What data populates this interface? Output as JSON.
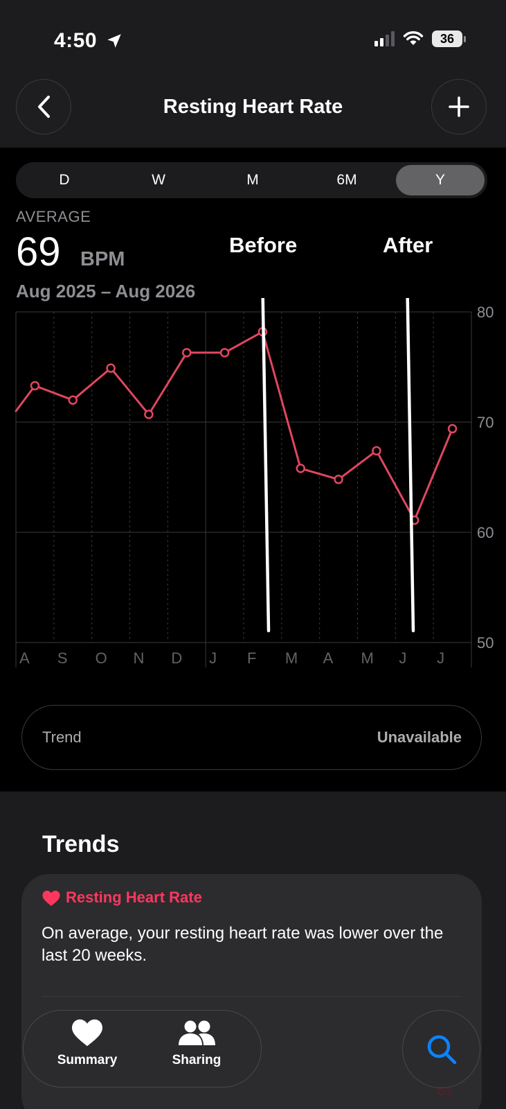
{
  "status_bar": {
    "time": "4:50",
    "battery": "36"
  },
  "header": {
    "title": "Resting Heart Rate"
  },
  "segments": [
    {
      "label": "D",
      "active": false
    },
    {
      "label": "W",
      "active": false
    },
    {
      "label": "M",
      "active": false
    },
    {
      "label": "6M",
      "active": false
    },
    {
      "label": "Y",
      "active": true
    }
  ],
  "summary": {
    "label": "AVERAGE",
    "value": "69",
    "unit": "BPM",
    "range": "Aug 2025 – Aug 2026"
  },
  "annotations": {
    "before": "Before",
    "after": "After"
  },
  "chart_data": {
    "type": "line",
    "categories": [
      "A",
      "S",
      "O",
      "N",
      "D",
      "J",
      "F",
      "M",
      "A",
      "M",
      "J",
      "J"
    ],
    "x": [
      "Aug 2025",
      "Sep 2025",
      "Oct 2025",
      "Nov 2025",
      "Dec 2025",
      "Jan 2026",
      "Feb 2026",
      "Mar 2026",
      "Apr 2026",
      "May 2026",
      "Jun 2026",
      "Jul 2026",
      "Aug 2026"
    ],
    "series": [
      {
        "values": [
          73.3,
          72.0,
          74.9,
          70.7,
          76.3,
          76.3,
          78.2,
          65.8,
          64.8,
          67.4,
          61.1,
          69.4
        ]
      }
    ],
    "leading_value": 71.0,
    "y_ticks": [
      50,
      60,
      70,
      80
    ],
    "ylim": [
      50,
      80
    ],
    "color": "#e0475f",
    "grid": true
  },
  "trend": {
    "label": "Trend",
    "value": "Unavailable"
  },
  "trends": {
    "heading": "Trends",
    "card_title": "Resting Heart Rate",
    "card_text": "On average, your resting heart rate was lower over the last 20 weeks.",
    "card_number": "65"
  },
  "tabbar": {
    "summary": "Summary",
    "sharing": "Sharing"
  }
}
